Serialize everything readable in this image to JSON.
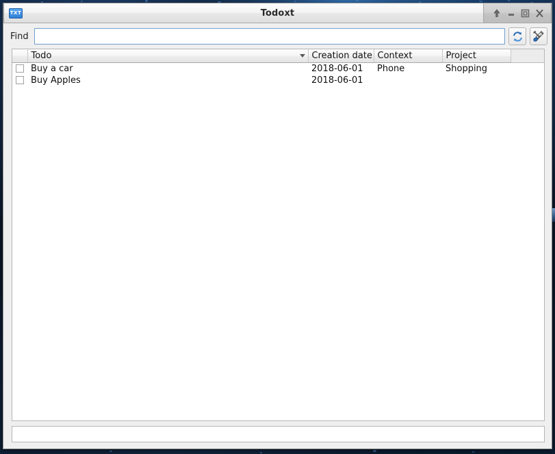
{
  "window": {
    "title": "Todoxt",
    "app_icon_label": "TXT",
    "controls": [
      {
        "name": "shade-button",
        "icon": "arrow-up-icon",
        "label": "Shade"
      },
      {
        "name": "minimize-button",
        "icon": "minimize-icon",
        "label": "Minimize"
      },
      {
        "name": "maximize-button",
        "icon": "maximize-icon",
        "label": "Maximize"
      },
      {
        "name": "close-button",
        "icon": "close-icon",
        "label": "Close"
      }
    ]
  },
  "findbar": {
    "label": "Find",
    "input_value": "",
    "input_placeholder": "",
    "buttons": [
      {
        "name": "refresh-button",
        "icon": "refresh-icon",
        "tooltip": "Refresh"
      },
      {
        "name": "settings-button",
        "icon": "tools-icon",
        "tooltip": "Settings"
      }
    ]
  },
  "table": {
    "columns": [
      {
        "key": "check",
        "label": ""
      },
      {
        "key": "todo",
        "label": "Todo",
        "sorted": true,
        "sort_direction": "desc"
      },
      {
        "key": "creation_date",
        "label": "Creation date"
      },
      {
        "key": "context",
        "label": "Context"
      },
      {
        "key": "project",
        "label": "Project"
      },
      {
        "key": "filler",
        "label": ""
      }
    ],
    "rows": [
      {
        "checked": false,
        "todo": "Buy a car",
        "creation_date": "2018-06-01",
        "context": "Phone",
        "project": "Shopping"
      },
      {
        "checked": false,
        "todo": "Buy Apples",
        "creation_date": "2018-06-01",
        "context": "",
        "project": ""
      }
    ]
  },
  "bottom": {
    "input_value": "",
    "input_placeholder": ""
  },
  "colors": {
    "accent": "#2f7fd6",
    "window_bg": "#efefef",
    "field_border_focus": "#6f9fd0",
    "desktop": "#0c1a2c"
  }
}
